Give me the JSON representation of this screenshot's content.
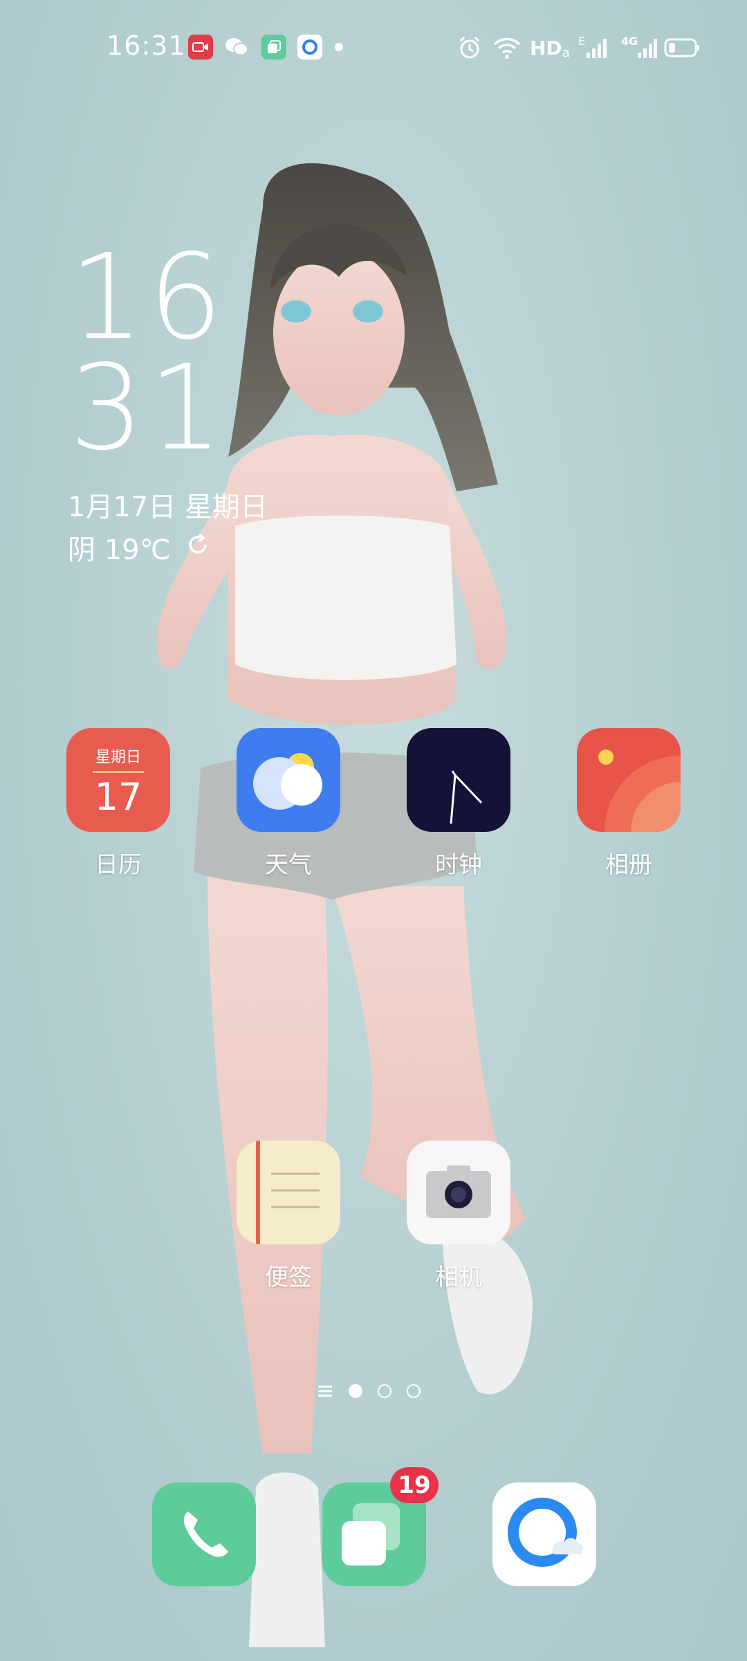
{
  "status_bar": {
    "time": "16:31",
    "network_label": "HD",
    "network_sub": "a",
    "signal1_label": "E",
    "signal2_label": "4G",
    "notification_icons": [
      "video-recorder-icon",
      "wechat-icon",
      "stack-icon",
      "qq-browser-icon"
    ],
    "right_icons": [
      "alarm-icon",
      "wifi-icon",
      "signal-icon",
      "battery-icon"
    ],
    "battery_level": 0.25
  },
  "clock_widget": {
    "hour": "16",
    "minute": "31",
    "date": "1月17日 星期日",
    "weather": "阴 19℃"
  },
  "apps_row1": [
    {
      "label": "日历",
      "icon": "calendar-icon",
      "weekday": "星期日",
      "day": "17"
    },
    {
      "label": "天气",
      "icon": "weather-icon"
    },
    {
      "label": "时钟",
      "icon": "clock-icon"
    },
    {
      "label": "相册",
      "icon": "photos-icon"
    }
  ],
  "apps_row2": [
    {
      "label": "便签",
      "icon": "notes-icon"
    },
    {
      "label": "相机",
      "icon": "camera-icon"
    }
  ],
  "pager": {
    "pages": 3,
    "active": 1
  },
  "dock": [
    {
      "icon": "phone-icon"
    },
    {
      "icon": "messages-icon",
      "badge": "19"
    },
    {
      "icon": "qq-browser-icon"
    }
  ],
  "colors": {
    "calendar_red": "#e85c4f",
    "weather_blue": "#3f7cf0",
    "clock_navy": "#141236",
    "photos_red": "#e8534a",
    "notes_cream": "#f6ebcb",
    "dock_green": "#5ecb9a",
    "badge_red": "#e8324a"
  }
}
